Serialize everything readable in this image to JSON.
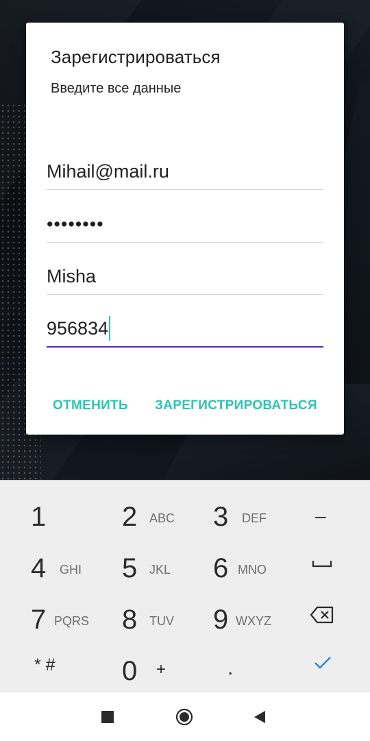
{
  "dialog": {
    "title": "Зарегистрироваться",
    "subtitle": "Введите все данные",
    "fields": {
      "email": "Mihail@mail.ru",
      "password_mask": "••••••••",
      "name": "Misha",
      "code": "956834"
    },
    "cancel_label": "ОТМЕНИТЬ",
    "register_label": "ЗАРЕГИСТРИРОВАТЬСЯ"
  },
  "keypad": {
    "keys": [
      {
        "digit": "1",
        "letters": ""
      },
      {
        "digit": "2",
        "letters": "ABC"
      },
      {
        "digit": "3",
        "letters": "DEF"
      },
      {
        "digit": "4",
        "letters": "GHI"
      },
      {
        "digit": "5",
        "letters": "JKL"
      },
      {
        "digit": "6",
        "letters": "MNO"
      },
      {
        "digit": "7",
        "letters": "PQRS"
      },
      {
        "digit": "8",
        "letters": "TUV"
      },
      {
        "digit": "9",
        "letters": "WXYZ"
      },
      {
        "digit": "0",
        "letters": "+"
      }
    ],
    "minus": "–",
    "star_hash": "* #",
    "dot": ".",
    "icons": {
      "space": "space-icon",
      "backspace": "backspace-icon",
      "done": "checkmark-icon"
    }
  },
  "navbar": {
    "icons": [
      "recents-square-icon",
      "home-circle-icon",
      "back-triangle-icon"
    ]
  },
  "colors": {
    "accent": "#2bc4b5",
    "focus_underline": "#5a22c8",
    "keypad_bg": "#eeeeee"
  }
}
